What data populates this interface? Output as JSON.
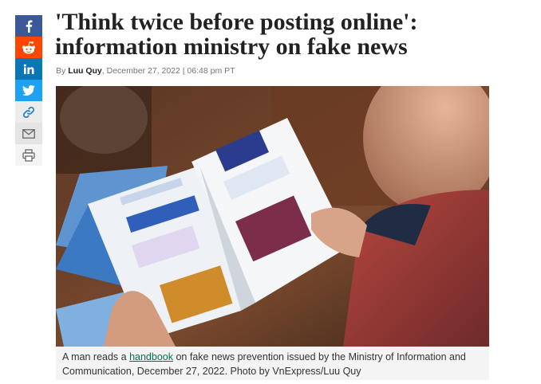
{
  "article": {
    "headline": "'Think twice before posting online': information ministry on fake news",
    "byline_prefix": "By",
    "author": "Luu Quy",
    "dateline": "December 27, 2022 | 06:48 pm PT"
  },
  "share": {
    "buttons": [
      {
        "name": "facebook-icon",
        "glyph": "f",
        "color": "#3b5998"
      },
      {
        "name": "reddit-icon",
        "color": "#ff4500"
      },
      {
        "name": "linkedin-icon",
        "glyph": "in",
        "color": "#0a77b5"
      },
      {
        "name": "twitter-icon",
        "color": "#1da1f2"
      },
      {
        "name": "link-icon",
        "color": "#ececec"
      },
      {
        "name": "mail-icon",
        "color": "#e4e4e4"
      },
      {
        "name": "print-icon",
        "color": "#f4f4f4"
      }
    ]
  },
  "photo": {
    "caption_before": "A man reads a ",
    "caption_link": "handbook",
    "caption_after": " on fake news prevention issued by the Ministry of Information and Communication, December 27, 2022. Photo by VnExpress/Luu Quy"
  },
  "colors": {
    "headline": "#222222",
    "caption_link": "#076f4f"
  }
}
